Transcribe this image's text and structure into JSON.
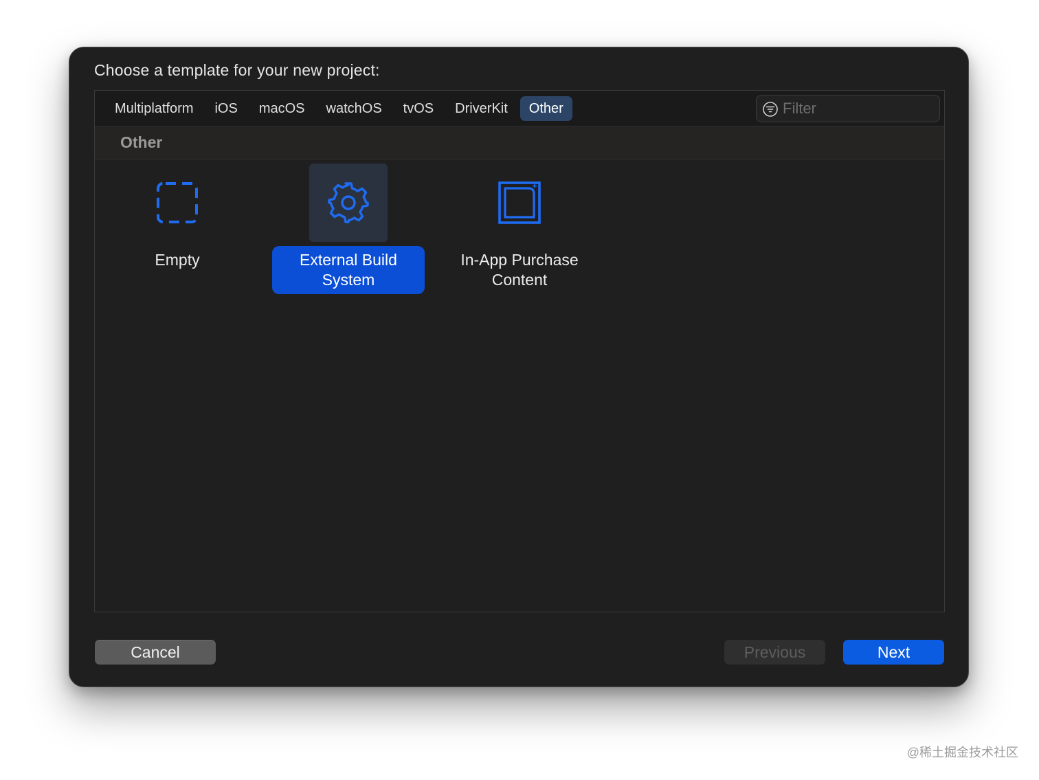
{
  "dialog": {
    "prompt": "Choose a template for your new project:"
  },
  "tabs": [
    {
      "label": "Multiplatform",
      "selected": false
    },
    {
      "label": "iOS",
      "selected": false
    },
    {
      "label": "macOS",
      "selected": false
    },
    {
      "label": "watchOS",
      "selected": false
    },
    {
      "label": "tvOS",
      "selected": false
    },
    {
      "label": "DriverKit",
      "selected": false
    },
    {
      "label": "Other",
      "selected": true
    }
  ],
  "filter": {
    "placeholder": "Filter",
    "value": "",
    "icon": "filter-circle-icon"
  },
  "section": {
    "title": "Other"
  },
  "templates": [
    {
      "label": "Empty",
      "icon": "dashed-square-icon",
      "selected": false
    },
    {
      "label": "External Build\nSystem",
      "icon": "gear-icon",
      "selected": true
    },
    {
      "label": "In-App Purchase\nContent",
      "icon": "framed-square-plus-icon",
      "selected": false
    }
  ],
  "buttons": {
    "cancel": "Cancel",
    "previous": "Previous",
    "next": "Next"
  },
  "colors": {
    "accent": "#0b5ce0",
    "selected_tab": "#2c4567",
    "icon_blue": "#1f6cf3"
  },
  "watermark": "@稀土掘金技术社区"
}
